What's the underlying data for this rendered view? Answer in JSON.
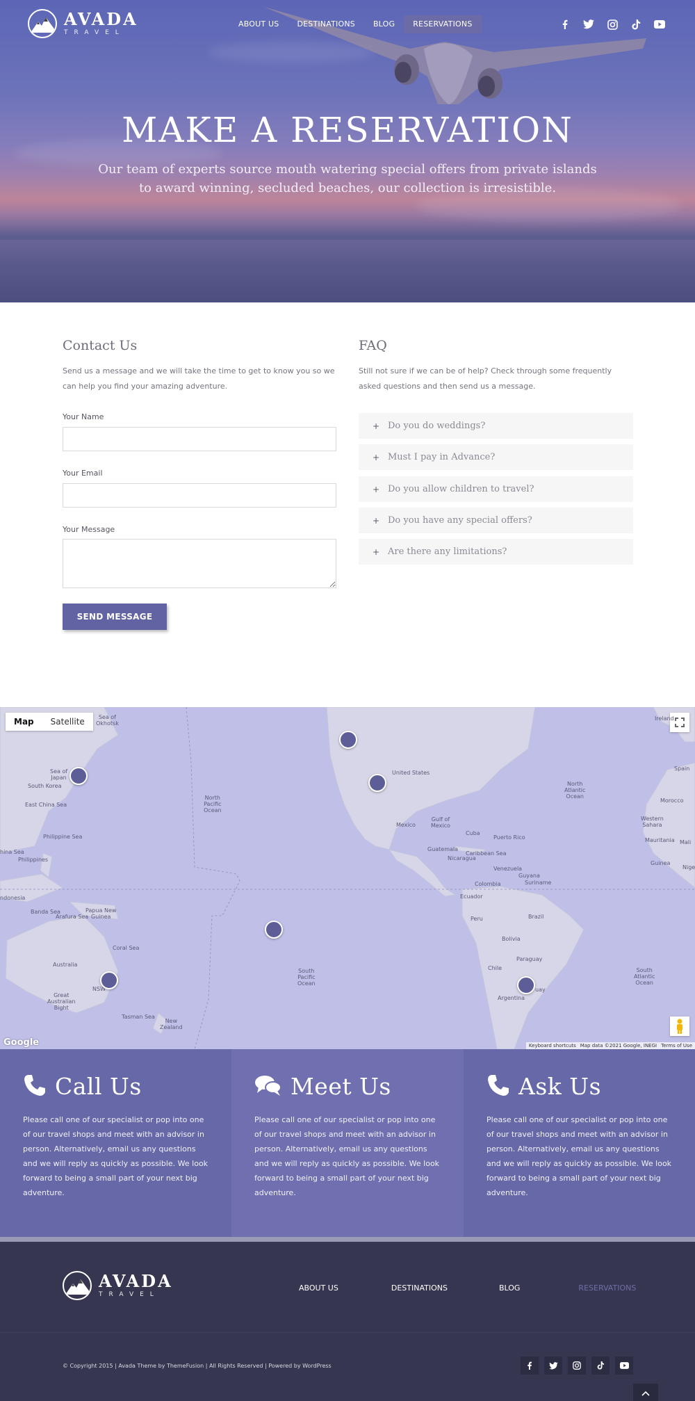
{
  "brand": {
    "name": "AVADA",
    "subtitle": "TRAVEL"
  },
  "nav": {
    "items": [
      "ABOUT US",
      "DESTINATIONS",
      "BLOG",
      "RESERVATIONS"
    ],
    "active": "RESERVATIONS"
  },
  "social_icons": [
    "facebook-icon",
    "twitter-icon",
    "instagram-icon",
    "tiktok-icon",
    "youtube-icon"
  ],
  "hero": {
    "title": "MAKE A RESERVATION",
    "subtitle": "Our team of experts source mouth watering special offers from private islands to award winning, secluded beaches, our collection is irresistible."
  },
  "contact": {
    "title": "Contact Us",
    "intro": "Send us a message and we will take the time to get to know you so we can help you find your amazing adventure.",
    "name_label": "Your Name",
    "name_value": "",
    "email_label": "Your Email",
    "email_value": "",
    "message_label": "Your Message",
    "message_value": "",
    "send_label": "SEND MESSAGE"
  },
  "faq": {
    "title": "FAQ",
    "intro": "Still not sure if we can be of help? Check through some frequently asked questions and then send us a message.",
    "items": [
      "Do you do weddings?",
      "Must I pay in Advance?",
      "Do you allow children to travel?",
      "Do you have any special offers?",
      "Are there any limitations?"
    ]
  },
  "map": {
    "type_buttons": [
      "Map",
      "Satellite"
    ],
    "active_type": "Map",
    "labels": {
      "sea_okhotsk": "Sea of\nOkhotsk",
      "sea_japan": "Sea of\nJapan",
      "south_korea": "South Korea",
      "east_china_sea": "East China Sea",
      "philippine_sea": "Philippine Sea",
      "china_sea": "hina Sea",
      "philippines": "Philippines",
      "indonesia": "ndonesia",
      "banda_sea": "Banda Sea",
      "arafura_sea": "Arafura Sea",
      "papua": "Papua New\nGuinea",
      "coral_sea": "Coral Sea",
      "australia": "Australia",
      "nsw": "NSW",
      "great_bight": "Great\nAustralian\nBight",
      "tasman_sea": "Tasman Sea",
      "new_zealand": "New\nZealand",
      "north_pacific": "North\nPacific\nOcean",
      "south_pacific": "South\nPacific\nOcean",
      "united_states": "United States",
      "mexico": "Mexico",
      "gulf_mexico": "Gulf of\nMexico",
      "cuba": "Cuba",
      "puerto_rico": "Puerto Rico",
      "guatemala": "Guatemala",
      "nicaragua": "Nicaragua",
      "caribbean": "Caribbean Sea",
      "venezuela": "Venezuela",
      "guyana": "Guyana",
      "suriname": "Suriname",
      "colombia": "Colombia",
      "ecuador": "Ecuador",
      "peru": "Peru",
      "brazil": "Brazil",
      "bolivia": "Bolivia",
      "paraguay": "Paraguay",
      "chile": "Chile",
      "argentina": "Argentina",
      "uruguay": "uay",
      "north_atlantic": "North\nAtlantic\nOcean",
      "south_atlantic": "South\nAtlantic\nOcean",
      "ireland": "Ireland",
      "spain": "Spain",
      "morocco": "Morocco",
      "western_sahara": "Western\nSahara",
      "mauritania": "Mauritania",
      "mali": "Mali",
      "guinea": "Guinea",
      "nigeria": "Nige"
    },
    "google": "Google",
    "attribution": [
      "Keyboard shortcuts",
      "Map data ©2021 Google, INEGI",
      "Terms of Use"
    ]
  },
  "info": [
    {
      "title": "Call Us",
      "icon": "phone-icon",
      "text": "Please call one of our specialist or pop into one of our travel shops and meet with an advisor in person. Alternatively, email us any questions and we will reply as quickly as possible. We look forward to being a small part of your next big adventure.",
      "bg": "#6768a8"
    },
    {
      "title": "Meet Us",
      "icon": "chat-icon",
      "text": "Please call one of our specialist or pop into one of our travel shops and meet with an advisor in person. Alternatively, email us any questions and we will reply as quickly as possible. We look forward to being a small part of your next big adventure.",
      "bg": "#7070b0"
    },
    {
      "title": "Ask Us",
      "icon": "phone-icon",
      "text": "Please call one of our specialist or pop into one of our travel shops and meet with an advisor in person. Alternatively, email us any questions and we will reply as quickly as possible. We look forward to being a small part of your next big adventure.",
      "bg": "#6768a8"
    }
  ],
  "footer": {
    "nav": [
      "ABOUT US",
      "DESTINATIONS",
      "BLOG",
      "RESERVATIONS"
    ],
    "copyright": "© Copyright 2015 | Avada Theme by ThemeFusion | All Rights Reserved | Powered by WordPress"
  },
  "colors": {
    "accent": "#6263a2",
    "footer_bg": "#363650",
    "map_water": "#bfbfe8",
    "footer_active": "#6f6fa8"
  }
}
